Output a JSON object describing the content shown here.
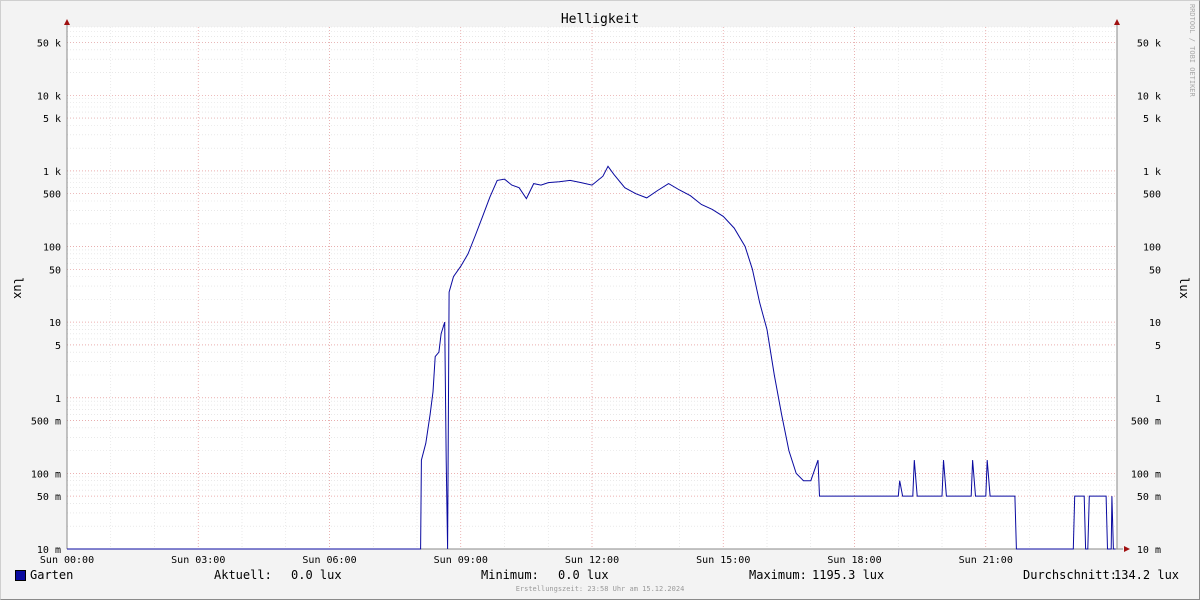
{
  "chart_data": {
    "type": "line",
    "title": "Helligkeit",
    "ylabel": "lux",
    "yscale": "log",
    "ylim": [
      0.01,
      80000
    ],
    "xlim": [
      "Sun 00:00",
      "Sun 24:00"
    ],
    "x_ticks": [
      "Sun 00:00",
      "Sun 03:00",
      "Sun 06:00",
      "Sun 09:00",
      "Sun 12:00",
      "Sun 15:00",
      "Sun 18:00",
      "Sun 21:00"
    ],
    "y_ticks": [
      {
        "value": 0.01,
        "label": "10 m"
      },
      {
        "value": 0.05,
        "label": "50 m"
      },
      {
        "value": 0.1,
        "label": "100 m"
      },
      {
        "value": 0.5,
        "label": "500 m"
      },
      {
        "value": 1,
        "label": "1"
      },
      {
        "value": 5,
        "label": "5"
      },
      {
        "value": 10,
        "label": "10"
      },
      {
        "value": 50,
        "label": "50"
      },
      {
        "value": 100,
        "label": "100"
      },
      {
        "value": 500,
        "label": "500"
      },
      {
        "value": 1000,
        "label": "1 k"
      },
      {
        "value": 5000,
        "label": "5 k"
      },
      {
        "value": 10000,
        "label": "10 k"
      },
      {
        "value": 50000,
        "label": "50 k"
      }
    ],
    "grid": true,
    "series": [
      {
        "name": "Garten",
        "color": "#0a0aa0",
        "points": [
          [
            "Sun 00:00",
            0.01
          ],
          [
            "Sun 08:05",
            0.01
          ],
          [
            "Sun 08:06",
            0.15
          ],
          [
            "Sun 08:12",
            0.25
          ],
          [
            "Sun 08:18",
            0.6
          ],
          [
            "Sun 08:22",
            1.2
          ],
          [
            "Sun 08:25",
            3.5
          ],
          [
            "Sun 08:30",
            4.0
          ],
          [
            "Sun 08:33",
            7.0
          ],
          [
            "Sun 08:38",
            10.0
          ],
          [
            "Sun 08:40",
            0.15
          ],
          [
            "Sun 08:42",
            0.01
          ],
          [
            "Sun 08:44",
            25
          ],
          [
            "Sun 08:50",
            40
          ],
          [
            "Sun 09:00",
            55
          ],
          [
            "Sun 09:10",
            80
          ],
          [
            "Sun 09:20",
            140
          ],
          [
            "Sun 09:30",
            250
          ],
          [
            "Sun 09:40",
            450
          ],
          [
            "Sun 09:50",
            750
          ],
          [
            "Sun 10:00",
            780
          ],
          [
            "Sun 10:10",
            650
          ],
          [
            "Sun 10:20",
            600
          ],
          [
            "Sun 10:30",
            430
          ],
          [
            "Sun 10:40",
            680
          ],
          [
            "Sun 10:50",
            650
          ],
          [
            "Sun 11:00",
            700
          ],
          [
            "Sun 11:15",
            720
          ],
          [
            "Sun 11:30",
            750
          ],
          [
            "Sun 11:45",
            700
          ],
          [
            "Sun 12:00",
            650
          ],
          [
            "Sun 12:15",
            850
          ],
          [
            "Sun 12:22",
            1150
          ],
          [
            "Sun 12:30",
            900
          ],
          [
            "Sun 12:45",
            600
          ],
          [
            "Sun 13:00",
            500
          ],
          [
            "Sun 13:15",
            440
          ],
          [
            "Sun 13:30",
            550
          ],
          [
            "Sun 13:45",
            680
          ],
          [
            "Sun 14:00",
            560
          ],
          [
            "Sun 14:15",
            470
          ],
          [
            "Sun 14:30",
            360
          ],
          [
            "Sun 14:45",
            310
          ],
          [
            "Sun 15:00",
            250
          ],
          [
            "Sun 15:15",
            175
          ],
          [
            "Sun 15:30",
            100
          ],
          [
            "Sun 15:40",
            50
          ],
          [
            "Sun 15:50",
            18
          ],
          [
            "Sun 16:00",
            8
          ],
          [
            "Sun 16:10",
            2.0
          ],
          [
            "Sun 16:20",
            0.6
          ],
          [
            "Sun 16:30",
            0.2
          ],
          [
            "Sun 16:40",
            0.1
          ],
          [
            "Sun 16:50",
            0.08
          ],
          [
            "Sun 17:00",
            0.08
          ],
          [
            "Sun 17:10",
            0.15
          ],
          [
            "Sun 17:12",
            0.05
          ],
          [
            "Sun 19:00",
            0.05
          ],
          [
            "Sun 19:02",
            0.08
          ],
          [
            "Sun 19:06",
            0.05
          ],
          [
            "Sun 19:20",
            0.05
          ],
          [
            "Sun 19:22",
            0.15
          ],
          [
            "Sun 19:26",
            0.05
          ],
          [
            "Sun 20:00",
            0.05
          ],
          [
            "Sun 20:02",
            0.15
          ],
          [
            "Sun 20:06",
            0.05
          ],
          [
            "Sun 20:40",
            0.05
          ],
          [
            "Sun 20:42",
            0.15
          ],
          [
            "Sun 20:46",
            0.05
          ],
          [
            "Sun 21:00",
            0.05
          ],
          [
            "Sun 21:02",
            0.15
          ],
          [
            "Sun 21:06",
            0.05
          ],
          [
            "Sun 21:40",
            0.05
          ],
          [
            "Sun 21:42",
            0.01
          ],
          [
            "Sun 23:00",
            0.01
          ],
          [
            "Sun 23:02",
            0.05
          ],
          [
            "Sun 23:15",
            0.05
          ],
          [
            "Sun 23:17",
            0.01
          ],
          [
            "Sun 23:20",
            0.01
          ],
          [
            "Sun 23:22",
            0.05
          ],
          [
            "Sun 23:45",
            0.05
          ],
          [
            "Sun 23:47",
            0.01
          ],
          [
            "Sun 23:52",
            0.01
          ],
          [
            "Sun 23:53",
            0.05
          ],
          [
            "Sun 23:55",
            0.01
          ],
          [
            "Sun 23:58",
            0.01
          ]
        ]
      }
    ]
  },
  "legend": {
    "series_name": "Garten",
    "current_label": "Aktuell:",
    "current_value": "0.0 lux",
    "min_label": "Minimum:",
    "min_value": "0.0 lux",
    "max_label": "Maximum:",
    "max_value": "1195.3 lux",
    "avg_label": "Durchschnitt:",
    "avg_value": "134.2 lux"
  },
  "footer": "Erstellungszeit: 23:58 Uhr am 15.12.2024",
  "watermark": "RRDTOOL / TOBI OETIKER"
}
